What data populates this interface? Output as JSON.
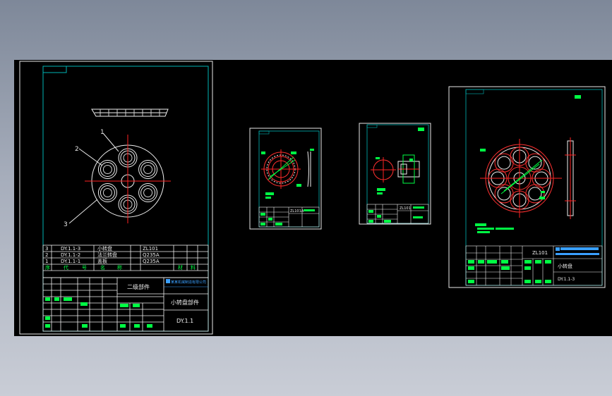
{
  "sheet1": {
    "balloons": [
      "1",
      "2",
      "3"
    ],
    "bom_rows": [
      {
        "idx": "3",
        "code": "DY.1.1-3",
        "name": "小转盘",
        "material": "ZL101"
      },
      {
        "idx": "2",
        "code": "DY.1.1-2",
        "name": "法兰转盘",
        "material": "Q235A"
      },
      {
        "idx": "1",
        "code": "DY.1.1-1",
        "name": "盖板",
        "material": "Q235A"
      }
    ],
    "bom_header": [
      "序",
      "代",
      "号",
      "名",
      "称",
      "材",
      "料"
    ],
    "title_block": {
      "assembly_label": "二级部件",
      "company": "某某机械制造有限公司",
      "drawing_name": "小转盘部件",
      "drawing_number": "DY.1.1"
    }
  },
  "sheet2": {
    "material": "ZL101A"
  },
  "sheet3": {
    "material": "ZL101"
  },
  "sheet4": {
    "material": "ZL101",
    "part_name": "小转盘",
    "drawing_number": "DY.1.1-3"
  }
}
